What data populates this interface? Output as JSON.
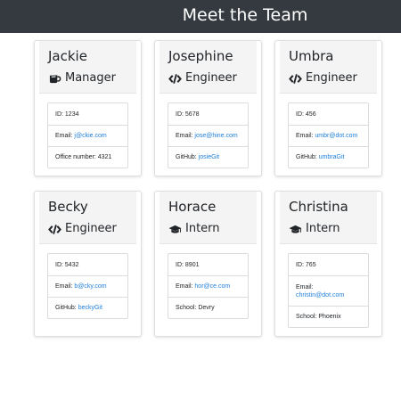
{
  "header": {
    "title": "Meet the Team"
  },
  "team": [
    {
      "name": "Jackie",
      "role": "Manager",
      "role_icon": "mug-icon",
      "id_label": "ID:",
      "id": "1234",
      "email_label": "Email:",
      "email": "j@ckie.com",
      "extra_label": "Office number:",
      "extra": "4321",
      "extra_is_link": false
    },
    {
      "name": "Josephine",
      "role": "Engineer",
      "role_icon": "code-icon",
      "id_label": "ID:",
      "id": "5678",
      "email_label": "Email:",
      "email": "jose@hine.com",
      "extra_label": "GitHub:",
      "extra": "josieGit",
      "extra_is_link": true
    },
    {
      "name": "Umbra",
      "role": "Engineer",
      "role_icon": "code-icon",
      "id_label": "ID:",
      "id": "456",
      "email_label": "Email:",
      "email": "umbr@dot.com",
      "extra_label": "GitHub:",
      "extra": "umbraGit",
      "extra_is_link": true
    },
    {
      "name": "Becky",
      "role": "Engineer",
      "role_icon": "code-icon",
      "id_label": "ID:",
      "id": "5432",
      "email_label": "Email:",
      "email": "b@cky.com",
      "extra_label": "GitHub:",
      "extra": "beckyGit",
      "extra_is_link": true
    },
    {
      "name": "Horace",
      "role": "Intern",
      "role_icon": "graduation-cap-icon",
      "id_label": "ID:",
      "id": "8901",
      "email_label": "Email:",
      "email": "hor@ce.com",
      "extra_label": "School:",
      "extra": "Devry",
      "extra_is_link": false
    },
    {
      "name": "Christina",
      "role": "Intern",
      "role_icon": "graduation-cap-icon",
      "id_label": "ID:",
      "id": "765",
      "email_label": "Email:",
      "email": "christin@dot.com",
      "extra_label": "School:",
      "extra": "Phoenix",
      "extra_is_link": false
    }
  ],
  "colors": {
    "header_bg": "#343a40",
    "link": "#1e7ed9",
    "card_header_bg": "#f4f4f4"
  }
}
